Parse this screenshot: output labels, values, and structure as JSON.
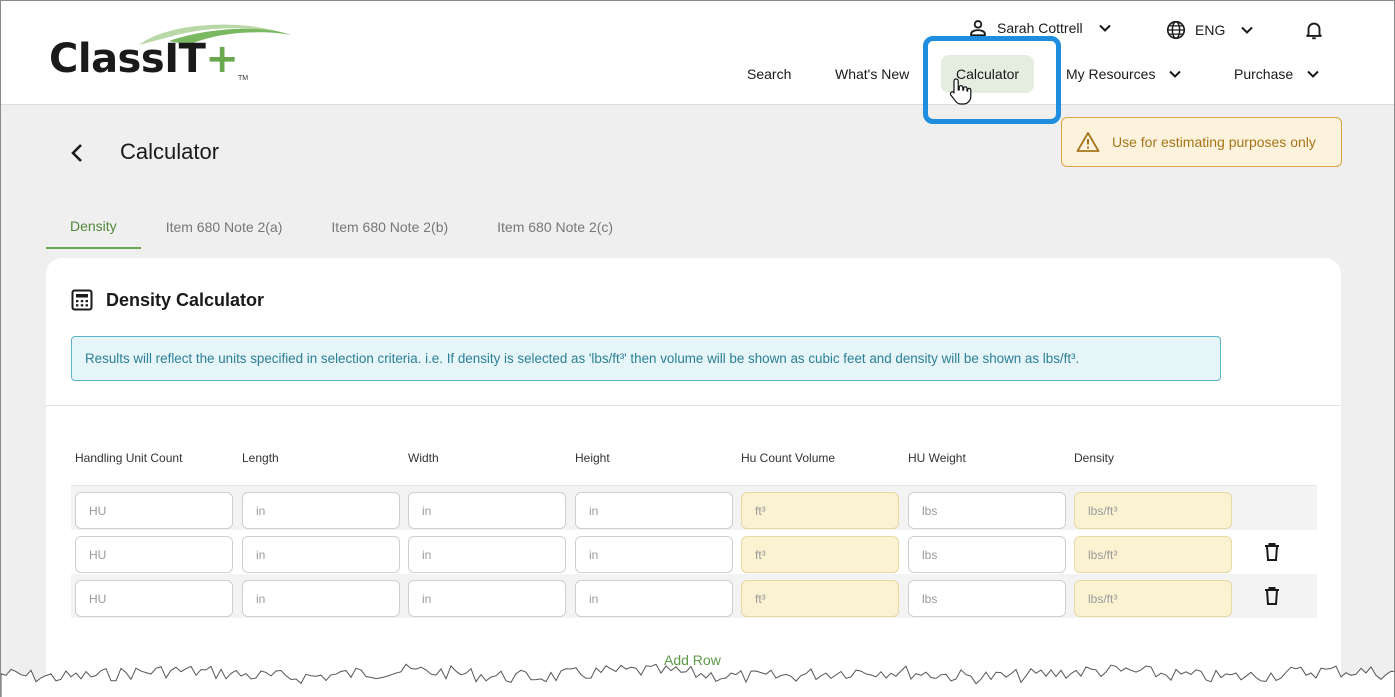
{
  "logo": {
    "main": "Class",
    "highlight": "IT",
    "plus": "+",
    "tm": "TM"
  },
  "user": {
    "name": "Sarah Cottrell"
  },
  "language": {
    "code": "ENG"
  },
  "nav": {
    "search": "Search",
    "whats_new": "What's New",
    "calculator": "Calculator",
    "my_resources": "My Resources",
    "purchase": "Purchase"
  },
  "page": {
    "title": "Calculator"
  },
  "warning": {
    "text": "Use for estimating purposes only"
  },
  "tabs": [
    {
      "label": "Density",
      "active": true
    },
    {
      "label": "Item 680 Note 2(a)",
      "active": false
    },
    {
      "label": "Item 680 Note 2(b)",
      "active": false
    },
    {
      "label": "Item 680 Note 2(c)",
      "active": false
    }
  ],
  "card": {
    "title": "Density Calculator",
    "info": "Results will reflect the units specified in selection criteria. i.e. If density is selected as 'lbs/ft³' then volume will be shown as cubic feet and density will be shown as lbs/ft³."
  },
  "table": {
    "headers": [
      "Handling Unit Count",
      "Length",
      "Width",
      "Height",
      "Hu Count Volume",
      "HU Weight",
      "Density"
    ],
    "placeholders": [
      "HU",
      "in",
      "in",
      "in",
      "ft³",
      "lbs",
      "lbs/ft³"
    ],
    "rows": [
      {
        "deletable": false
      },
      {
        "deletable": true
      },
      {
        "deletable": true
      }
    ]
  },
  "add_row": "Add Row",
  "colors": {
    "accent_green": "#6aa84f",
    "highlight_blue": "#1f8de0",
    "warning_bg": "#fdf3dd",
    "info_bg": "#e6f5f8",
    "calc_field_bg": "#fbf2d2"
  }
}
